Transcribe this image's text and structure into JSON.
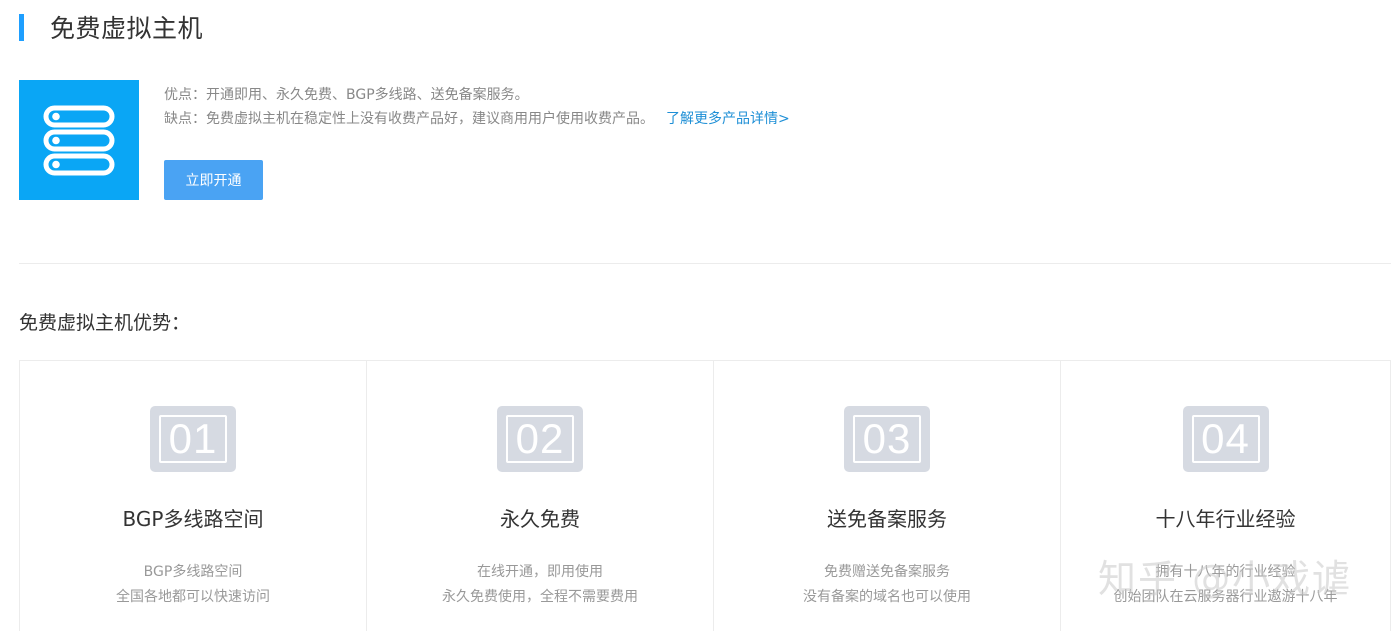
{
  "header": {
    "title": "免费虚拟主机"
  },
  "product": {
    "icon": "server-stack-icon",
    "icon_color": "#0aa6f5",
    "pros": "优点：开通即用、永久免费、BGP多线路、送免备案服务。",
    "cons": "缺点：免费虚拟主机在稳定性上没有收费产品好，建议商用用户使用收费产品。",
    "more_link": "了解更多产品详情>",
    "open_button": "立即开通"
  },
  "advantages": {
    "title": "免费虚拟主机优势：",
    "items": [
      {
        "num": "01",
        "title": "BGP多线路空间",
        "line1": "BGP多线路空间",
        "line2": "全国各地都可以快速访问"
      },
      {
        "num": "02",
        "title": "永久免费",
        "line1": "在线开通，即用使用",
        "line2": "永久免费使用，全程不需要费用"
      },
      {
        "num": "03",
        "title": "送免备案服务",
        "line1": "免费赠送免备案服务",
        "line2": "没有备案的域名也可以使用"
      },
      {
        "num": "04",
        "title": "十八年行业经验",
        "line1": "拥有十八年的行业经验",
        "line2": "创始团队在云服务器行业遨游十八年"
      }
    ]
  },
  "watermark": "知乎 @小戏谑",
  "colors": {
    "accent": "#1e9fff",
    "button": "#4aa3f3",
    "link": "#1e8fd6",
    "number_tile": "#d6dae2"
  }
}
